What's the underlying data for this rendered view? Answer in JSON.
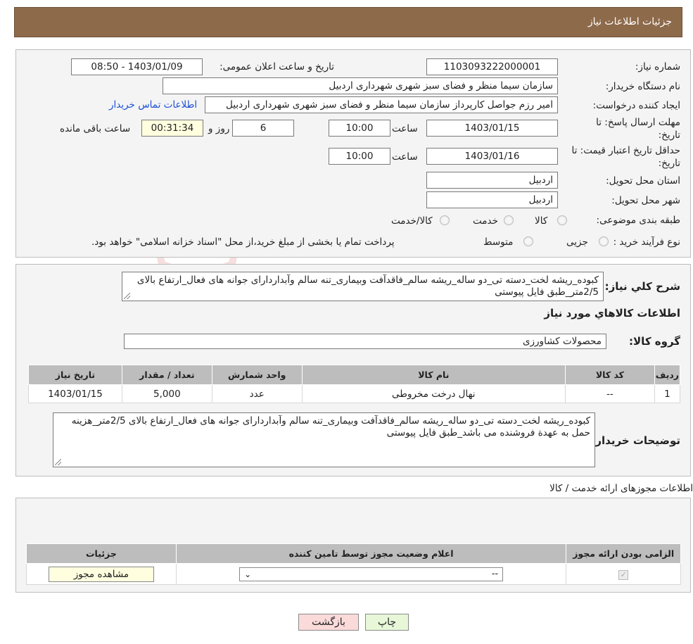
{
  "header": {
    "title": "جزئیات اطلاعات نیاز"
  },
  "watermark": {
    "text": "AriaTender.neT"
  },
  "info": {
    "need_number_label": "شماره نیاز:",
    "need_number": "1103093222000001",
    "announce_label": "تاریخ و ساعت اعلان عمومی:",
    "announce_value": "1403/01/09 - 08:50",
    "buyer_org_label": "نام دستگاه خریدار:",
    "buyer_org": "سازمان سیما منظر و فضای سبز شهری شهرداری اردبیل",
    "creator_label": "ایجاد کننده درخواست:",
    "creator": "امیر رزم جواصل کارپرداز سازمان سیما منظر و فضای سبز شهری شهرداری اردبیل",
    "contact_link": "اطلاعات تماس خریدار",
    "deadline_label_1": "مهلت ارسال پاسخ: تا",
    "deadline_label_2": "تاریخ:",
    "deadline_date": "1403/01/15",
    "time_label": "ساعت",
    "deadline_time": "10:00",
    "days_value": "6",
    "days_label": "روز و",
    "remaining_time": "00:31:34",
    "remaining_label": "ساعت باقی مانده",
    "validity_label_1": "حداقل تاریخ اعتبار قیمت: تا",
    "validity_label_2": "تاریخ:",
    "validity_date": "1403/01/16",
    "validity_time": "10:00",
    "province_label": "استان محل تحویل:",
    "province": "اردبیل",
    "city_label": "شهر محل تحویل:",
    "city": "اردبیل",
    "category_label": "طبقه بندی موضوعی:",
    "category_options": [
      "کالا",
      "خدمت",
      "کالا/خدمت"
    ],
    "process_label": "نوع فرآیند خرید :",
    "process_options": [
      "جزیی",
      "متوسط"
    ],
    "process_note": "پرداخت تمام یا بخشی از مبلغ خرید،از محل \"اسناد خزانه اسلامی\" خواهد بود."
  },
  "description": {
    "label": "شرح کلي نياز:",
    "text": "کبوده_ریشه لخت_دسته تی_دو ساله_ریشه سالم_فاقدآفت وبیماری_تنه سالم وآبداردارای جوانه های فعال_ارتفاع بالای 2/5متر_طبق فایل پیوستی"
  },
  "goods": {
    "section_title": "اطلاعات کالاهاي مورد نياز",
    "group_label": "گروه کالا:",
    "group_value": "محصولات کشاورزی",
    "columns": [
      "رديف",
      "کد کالا",
      "نام کالا",
      "واحد شمارش",
      "تعداد / مقدار",
      "تاريخ نياز"
    ],
    "rows": [
      [
        "1",
        "--",
        "نهال درخت مخروطی",
        "عدد",
        "5,000",
        "1403/01/15"
      ]
    ],
    "buyer_notes_label": "توضیحات خریدار:",
    "buyer_notes": "کبوده_ریشه لخت_دسته تی_دو ساله_ریشه سالم_فاقدآفت وبیماری_تنه سالم وآبداردارای جوانه های فعال_ارتفاع بالای 2/5متر_هزینه حمل به عهدة فروشنده می باشد_طبق فایل پیوستی"
  },
  "permits": {
    "section_title": "اطلاعات مجوزهای ارائه خدمت / کالا",
    "columns": [
      "الزامی بودن ارائه مجوز",
      "اعلام وضعیت مجوز توسط تامین کننده",
      "جزئیات"
    ],
    "select_value": "--",
    "view_button": "مشاهده مجوز"
  },
  "actions": {
    "print": "چاپ",
    "back": "بازگشت"
  },
  "colors": {
    "header_bg": "#8d6a4a",
    "panel_bg": "#f4f4f4",
    "table_header": "#bdbdbd",
    "print_btn": "#e8f7d8",
    "back_btn": "#fbdada"
  }
}
